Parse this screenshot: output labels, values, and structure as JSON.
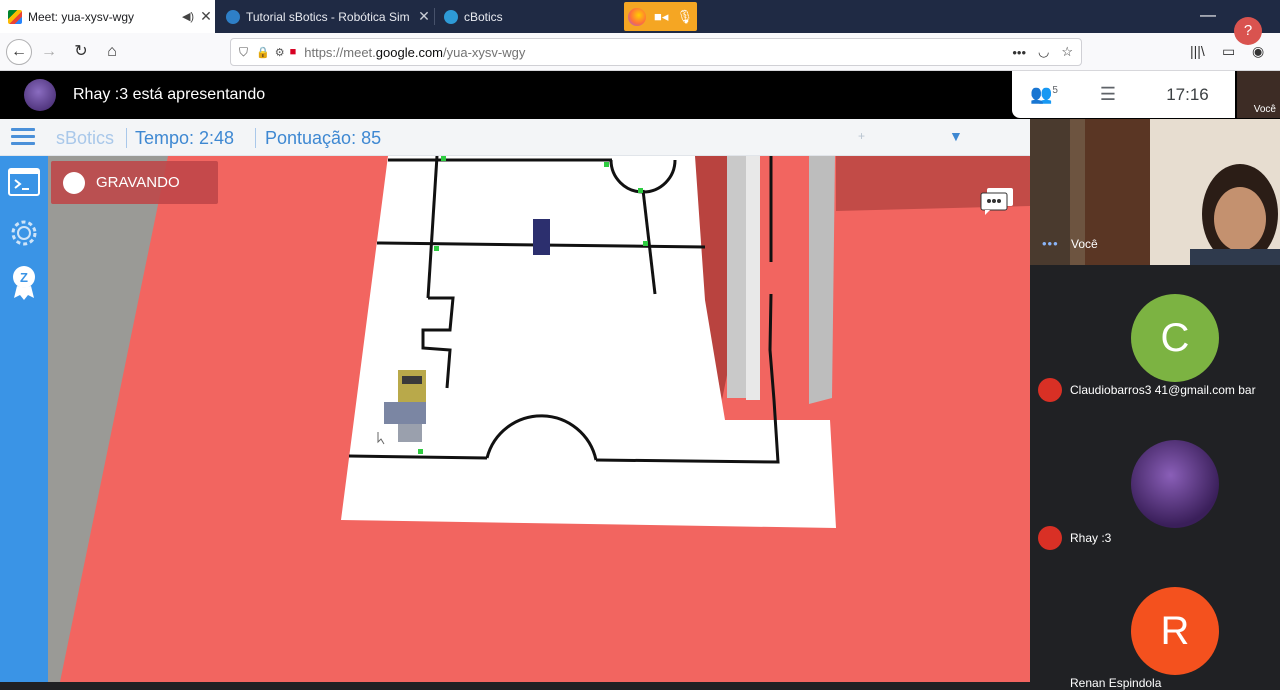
{
  "browser": {
    "tabs": [
      {
        "title": "Meet: yua-xysv-wgy",
        "favicon": "google-meet-icon",
        "active": true
      },
      {
        "title": "Tutorial sBotics - Robótica Sim",
        "favicon": "sbotics-icon",
        "active": false
      },
      {
        "title": "cBotics",
        "favicon": "cbotics-icon",
        "active": false
      }
    ],
    "url_prefix": "https://meet.",
    "url_host": "google.com",
    "url_path": "/yua-xysv-wgy"
  },
  "meet": {
    "presenter_text": "Rhay :3 está apresentando",
    "people_count": "5",
    "clock": "17:16",
    "self_thumb_label": "Você",
    "help_label": "?",
    "participants": [
      {
        "name": "Você",
        "self": true
      },
      {
        "name": "Claudiobarros3 41@gmail.com bar",
        "initial": "C",
        "color": "#7cb342",
        "muted": true
      },
      {
        "name": "Rhay :3",
        "initial": "",
        "color": "#4a2b6b",
        "muted": true
      },
      {
        "name": "Renan Espindola",
        "initial": "R",
        "color": "#f4511e",
        "muted": false
      }
    ]
  },
  "sbotics": {
    "brand": "sBotics",
    "time_label": "Tempo: 2:48",
    "score_label": "Pontuação: 85",
    "recording_label": "GRAVANDO"
  }
}
